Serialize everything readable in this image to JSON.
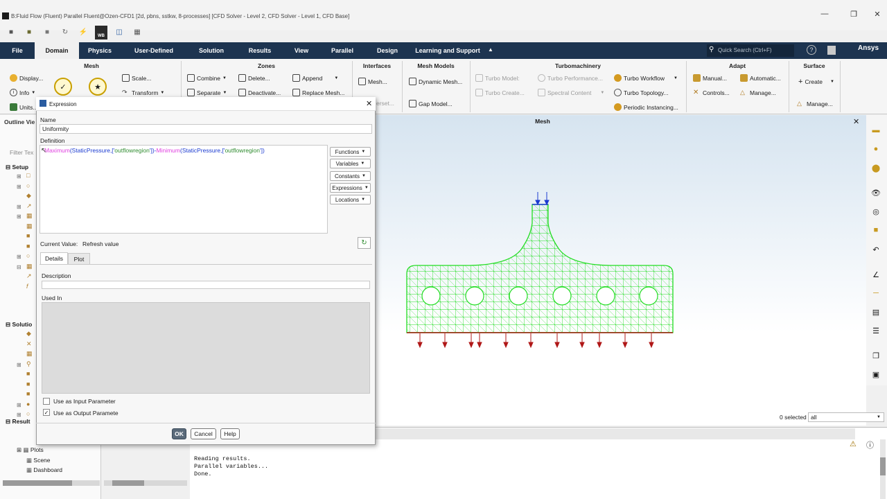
{
  "window": {
    "title": "B:Fluid Flow (Fluent) Parallel Fluent@Ozen-CFD1  [2d, pbns, sstkw, 8-processes] [CFD Solver - Level 2, CFD Solver - Level 1, CFD Base]"
  },
  "menu": {
    "tabs": [
      "File",
      "Domain",
      "Physics",
      "User-Defined",
      "Solution",
      "Results",
      "View",
      "Parallel",
      "Design",
      "Learning and Support"
    ],
    "active": "Domain",
    "search_placeholder": "Quick Search (Ctrl+F)",
    "brand": "Ansys"
  },
  "ribbon": {
    "mesh": {
      "header": "Mesh",
      "display": "Display...",
      "info": "Info",
      "units": "Units...",
      "scale": "Scale...",
      "transform": "Transform"
    },
    "zones": {
      "header": "Zones",
      "combine": "Combine",
      "separate": "Separate",
      "delete": "Delete...",
      "deactivate": "Deactivate...",
      "append": "Append",
      "replace_mesh": "Replace Mesh..."
    },
    "interfaces": {
      "header": "Interfaces",
      "mesh": "Mesh...",
      "overset": "erset..."
    },
    "mesh_models": {
      "header": "Mesh Models",
      "dynamic_mesh": "Dynamic Mesh...",
      "gap_model": "Gap Model..."
    },
    "turbo": {
      "header": "Turbomachinery",
      "turbo_model": "Turbo Model:",
      "turbo_create": "Turbo Create...",
      "turbo_performance": "Turbo Performance...",
      "spectral_content": "Spectral Content",
      "turbo_workflow": "Turbo Workflow",
      "turbo_topology": "Turbo Topology...",
      "periodic_instancing": "Periodic Instancing..."
    },
    "adapt": {
      "header": "Adapt",
      "manual": "Manual...",
      "controls": "Controls...",
      "automatic": "Automatic...",
      "manage": "Manage..."
    },
    "surface": {
      "header": "Surface",
      "create": "Create",
      "manage": "Manage..."
    }
  },
  "outline": {
    "title": "Outline Vie",
    "filter_placeholder": "Filter Tex",
    "setup": "Setup",
    "solution": "Solutio",
    "results": "Result",
    "plots": "Plots",
    "scene": "Scene",
    "dashboard": "Dashboard"
  },
  "graphics": {
    "title": "Mesh",
    "selected": "0 selected",
    "filter": "all"
  },
  "console": {
    "lines": "Reading results.\nParallel variables...\nDone."
  },
  "dialog": {
    "title": "Expression",
    "name_label": "Name",
    "name_value": "Uniformity",
    "definition_label": "Definition",
    "definition": {
      "fn1": "Maximum",
      "args1": "(StaticPressure,['",
      "loc1": "outflowregion",
      "close1": "'])-",
      "fn2": "Minimum",
      "args2": "(StaticPressure,['",
      "loc2": "outflowregion",
      "close2": "'])"
    },
    "buttons": [
      "Functions",
      "Variables",
      "Constants",
      "Expressions",
      "Locations"
    ],
    "current_value_label": "Current Value:",
    "refresh_value": "Refresh value",
    "tabs": [
      "Details",
      "Plot"
    ],
    "description_label": "Description",
    "used_in_label": "Used In",
    "use_as_input": "Use as Input Parameter",
    "use_as_output": "Use as Output Parameter",
    "use_as_input_checked": false,
    "use_as_output_checked": true,
    "ok": "OK",
    "cancel": "Cancel",
    "help": "Help"
  },
  "colors": {
    "menubar": "#1d3450",
    "mesh": "#22dd22",
    "pink": "#e040e0",
    "green_text": "#2e8b2e",
    "inlet": "#1a3ad0",
    "outlet": "#b01818"
  }
}
